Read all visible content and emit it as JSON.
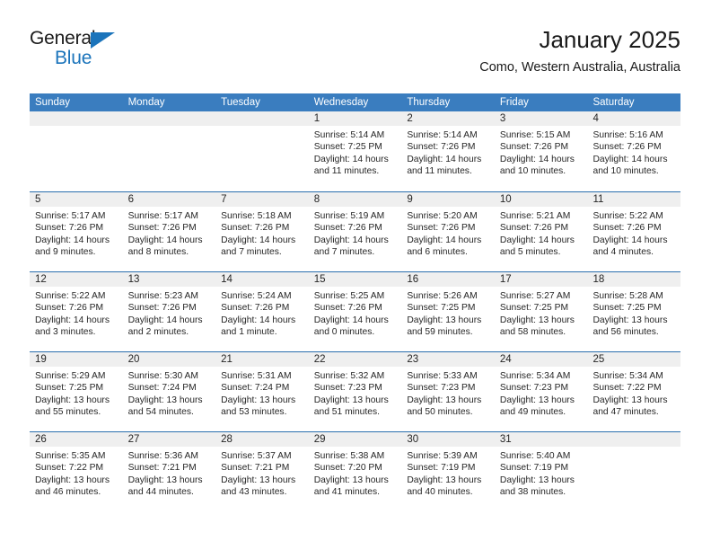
{
  "brand": {
    "name_top": "General",
    "name_bottom": "Blue",
    "triangle_color": "#1b74bb"
  },
  "header": {
    "title": "January 2025",
    "subtitle": "Como, Western Australia, Australia"
  },
  "theme": {
    "header_blue": "#3a7dbf",
    "row_rule_blue": "#2b6fae",
    "day_strip_gray": "#efefef"
  },
  "weekdays": [
    "Sunday",
    "Monday",
    "Tuesday",
    "Wednesday",
    "Thursday",
    "Friday",
    "Saturday"
  ],
  "labels": {
    "sunrise_prefix": "Sunrise: ",
    "sunset_prefix": "Sunset: ",
    "daylight_prefix": "Daylight: "
  },
  "weeks": [
    [
      {
        "day": "",
        "empty": true
      },
      {
        "day": "",
        "empty": true
      },
      {
        "day": "",
        "empty": true
      },
      {
        "day": "1",
        "sunrise": "Sunrise: 5:14 AM",
        "sunset": "Sunset: 7:25 PM",
        "daylight": "Daylight: 14 hours and 11 minutes."
      },
      {
        "day": "2",
        "sunrise": "Sunrise: 5:14 AM",
        "sunset": "Sunset: 7:26 PM",
        "daylight": "Daylight: 14 hours and 11 minutes."
      },
      {
        "day": "3",
        "sunrise": "Sunrise: 5:15 AM",
        "sunset": "Sunset: 7:26 PM",
        "daylight": "Daylight: 14 hours and 10 minutes."
      },
      {
        "day": "4",
        "sunrise": "Sunrise: 5:16 AM",
        "sunset": "Sunset: 7:26 PM",
        "daylight": "Daylight: 14 hours and 10 minutes."
      }
    ],
    [
      {
        "day": "5",
        "sunrise": "Sunrise: 5:17 AM",
        "sunset": "Sunset: 7:26 PM",
        "daylight": "Daylight: 14 hours and 9 minutes."
      },
      {
        "day": "6",
        "sunrise": "Sunrise: 5:17 AM",
        "sunset": "Sunset: 7:26 PM",
        "daylight": "Daylight: 14 hours and 8 minutes."
      },
      {
        "day": "7",
        "sunrise": "Sunrise: 5:18 AM",
        "sunset": "Sunset: 7:26 PM",
        "daylight": "Daylight: 14 hours and 7 minutes."
      },
      {
        "day": "8",
        "sunrise": "Sunrise: 5:19 AM",
        "sunset": "Sunset: 7:26 PM",
        "daylight": "Daylight: 14 hours and 7 minutes."
      },
      {
        "day": "9",
        "sunrise": "Sunrise: 5:20 AM",
        "sunset": "Sunset: 7:26 PM",
        "daylight": "Daylight: 14 hours and 6 minutes."
      },
      {
        "day": "10",
        "sunrise": "Sunrise: 5:21 AM",
        "sunset": "Sunset: 7:26 PM",
        "daylight": "Daylight: 14 hours and 5 minutes."
      },
      {
        "day": "11",
        "sunrise": "Sunrise: 5:22 AM",
        "sunset": "Sunset: 7:26 PM",
        "daylight": "Daylight: 14 hours and 4 minutes."
      }
    ],
    [
      {
        "day": "12",
        "sunrise": "Sunrise: 5:22 AM",
        "sunset": "Sunset: 7:26 PM",
        "daylight": "Daylight: 14 hours and 3 minutes."
      },
      {
        "day": "13",
        "sunrise": "Sunrise: 5:23 AM",
        "sunset": "Sunset: 7:26 PM",
        "daylight": "Daylight: 14 hours and 2 minutes."
      },
      {
        "day": "14",
        "sunrise": "Sunrise: 5:24 AM",
        "sunset": "Sunset: 7:26 PM",
        "daylight": "Daylight: 14 hours and 1 minute."
      },
      {
        "day": "15",
        "sunrise": "Sunrise: 5:25 AM",
        "sunset": "Sunset: 7:26 PM",
        "daylight": "Daylight: 14 hours and 0 minutes."
      },
      {
        "day": "16",
        "sunrise": "Sunrise: 5:26 AM",
        "sunset": "Sunset: 7:25 PM",
        "daylight": "Daylight: 13 hours and 59 minutes."
      },
      {
        "day": "17",
        "sunrise": "Sunrise: 5:27 AM",
        "sunset": "Sunset: 7:25 PM",
        "daylight": "Daylight: 13 hours and 58 minutes."
      },
      {
        "day": "18",
        "sunrise": "Sunrise: 5:28 AM",
        "sunset": "Sunset: 7:25 PM",
        "daylight": "Daylight: 13 hours and 56 minutes."
      }
    ],
    [
      {
        "day": "19",
        "sunrise": "Sunrise: 5:29 AM",
        "sunset": "Sunset: 7:25 PM",
        "daylight": "Daylight: 13 hours and 55 minutes."
      },
      {
        "day": "20",
        "sunrise": "Sunrise: 5:30 AM",
        "sunset": "Sunset: 7:24 PM",
        "daylight": "Daylight: 13 hours and 54 minutes."
      },
      {
        "day": "21",
        "sunrise": "Sunrise: 5:31 AM",
        "sunset": "Sunset: 7:24 PM",
        "daylight": "Daylight: 13 hours and 53 minutes."
      },
      {
        "day": "22",
        "sunrise": "Sunrise: 5:32 AM",
        "sunset": "Sunset: 7:23 PM",
        "daylight": "Daylight: 13 hours and 51 minutes."
      },
      {
        "day": "23",
        "sunrise": "Sunrise: 5:33 AM",
        "sunset": "Sunset: 7:23 PM",
        "daylight": "Daylight: 13 hours and 50 minutes."
      },
      {
        "day": "24",
        "sunrise": "Sunrise: 5:34 AM",
        "sunset": "Sunset: 7:23 PM",
        "daylight": "Daylight: 13 hours and 49 minutes."
      },
      {
        "day": "25",
        "sunrise": "Sunrise: 5:34 AM",
        "sunset": "Sunset: 7:22 PM",
        "daylight": "Daylight: 13 hours and 47 minutes."
      }
    ],
    [
      {
        "day": "26",
        "sunrise": "Sunrise: 5:35 AM",
        "sunset": "Sunset: 7:22 PM",
        "daylight": "Daylight: 13 hours and 46 minutes."
      },
      {
        "day": "27",
        "sunrise": "Sunrise: 5:36 AM",
        "sunset": "Sunset: 7:21 PM",
        "daylight": "Daylight: 13 hours and 44 minutes."
      },
      {
        "day": "28",
        "sunrise": "Sunrise: 5:37 AM",
        "sunset": "Sunset: 7:21 PM",
        "daylight": "Daylight: 13 hours and 43 minutes."
      },
      {
        "day": "29",
        "sunrise": "Sunrise: 5:38 AM",
        "sunset": "Sunset: 7:20 PM",
        "daylight": "Daylight: 13 hours and 41 minutes."
      },
      {
        "day": "30",
        "sunrise": "Sunrise: 5:39 AM",
        "sunset": "Sunset: 7:19 PM",
        "daylight": "Daylight: 13 hours and 40 minutes."
      },
      {
        "day": "31",
        "sunrise": "Sunrise: 5:40 AM",
        "sunset": "Sunset: 7:19 PM",
        "daylight": "Daylight: 13 hours and 38 minutes."
      },
      {
        "day": "",
        "empty": true
      }
    ]
  ]
}
